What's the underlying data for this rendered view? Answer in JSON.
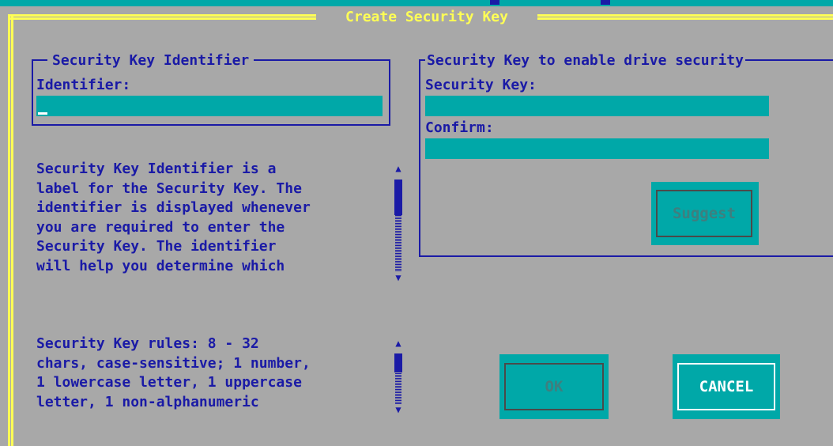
{
  "dialog": {
    "title": "Create Security Key"
  },
  "identifier_group": {
    "legend": "Security Key Identifier",
    "label": "Identifier:",
    "value": ""
  },
  "help_identifier": {
    "lines": [
      "Security Key Identifier is a",
      "label for the Security Key. The",
      "identifier is displayed whenever",
      "you are required to enter the",
      "Security Key. The identifier",
      "will help you determine which"
    ]
  },
  "help_rules": {
    "lines": [
      "Security Key rules: 8 - 32",
      "chars, case-sensitive; 1 number,",
      "1 lowercase letter, 1 uppercase",
      "letter, 1 non-alphanumeric"
    ]
  },
  "key_group": {
    "legend": "Security Key to enable drive security",
    "key_label": "Security Key:",
    "confirm_label": "Confirm:",
    "key_value": "",
    "confirm_value": "",
    "suggest_label": "Suggest"
  },
  "buttons": {
    "ok_label": "OK",
    "cancel_label": "CANCEL"
  },
  "icons": {
    "scroll_up": "▲",
    "scroll_down": "▼"
  },
  "colors": {
    "background": "#a8a8a8",
    "text": "#1a1aa6",
    "accent": "#00a8a8",
    "frame": "#ffff55",
    "focus": "#ffffff"
  }
}
